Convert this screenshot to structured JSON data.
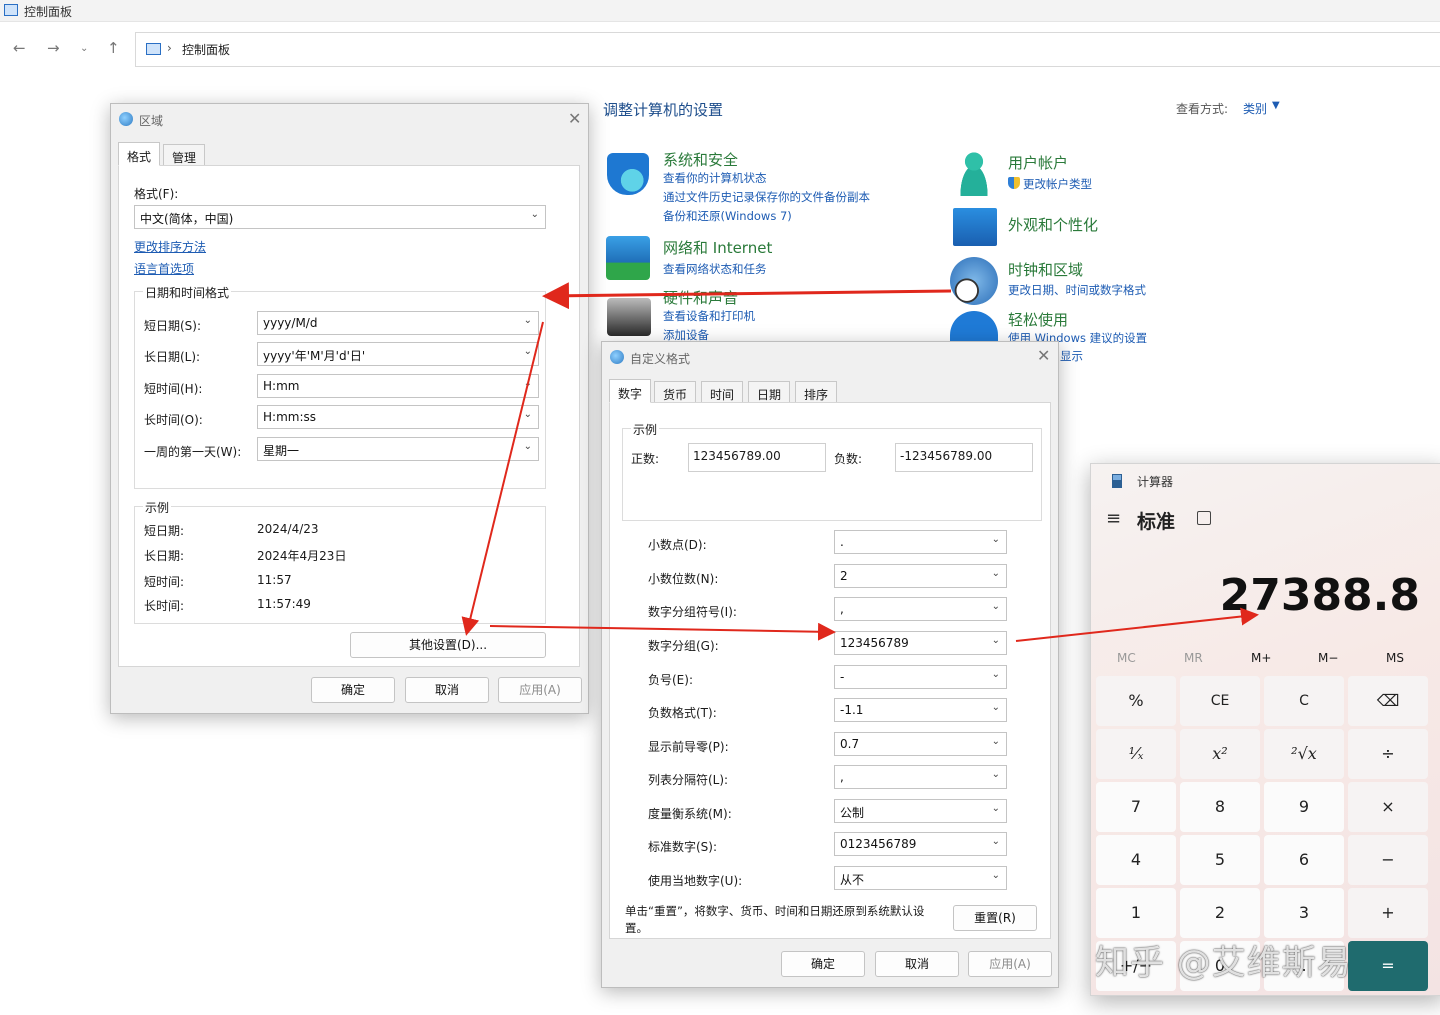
{
  "control_panel": {
    "window_title": "控制面板",
    "breadcrumb": "控制面板",
    "heading": "调整计算机的设置",
    "view_by_label": "查看方式:",
    "view_by_value": "类别",
    "categories": [
      {
        "title": "系统和安全",
        "links": [
          "查看你的计算机状态",
          "通过文件历史记录保存你的文件备份副本",
          "备份和还原(Windows 7)"
        ]
      },
      {
        "title": "网络和 Internet",
        "links": [
          "查看网络状态和任务"
        ]
      },
      {
        "title": "硬件和声音",
        "links": [
          "查看设备和打印机",
          "添加设备"
        ]
      },
      {
        "title": "用户帐户",
        "links": [
          "更改帐户类型"
        ]
      },
      {
        "title": "外观和个性化",
        "links": []
      },
      {
        "title": "时钟和区域",
        "links": [
          "更改日期、时间或数字格式"
        ]
      },
      {
        "title": "轻松使用",
        "links": [
          "使用 Windows 建议的设置",
          "显示"
        ]
      }
    ]
  },
  "region_dialog": {
    "title": "区域",
    "tabs": [
      "格式",
      "管理"
    ],
    "format_label": "格式(F):",
    "format_value": "中文(简体，中国)",
    "link_sort": "更改排序方法",
    "link_language": "语言首选项",
    "datetime_group": "日期和时间格式",
    "fields": [
      {
        "label": "短日期(S):",
        "value": "yyyy/M/d"
      },
      {
        "label": "长日期(L):",
        "value": "yyyy'年'M'月'd'日'"
      },
      {
        "label": "短时间(H):",
        "value": "H:mm"
      },
      {
        "label": "长时间(O):",
        "value": "H:mm:ss"
      },
      {
        "label": "一周的第一天(W):",
        "value": "星期一"
      }
    ],
    "example_group": "示例",
    "examples": [
      {
        "label": "短日期:",
        "value": "2024/4/23"
      },
      {
        "label": "长日期:",
        "value": "2024年4月23日"
      },
      {
        "label": "短时间:",
        "value": "11:57"
      },
      {
        "label": "长时间:",
        "value": "11:57:49"
      }
    ],
    "other_settings": "其他设置(D)...",
    "ok": "确定",
    "cancel": "取消",
    "apply": "应用(A)"
  },
  "custom_dialog": {
    "title": "自定义格式",
    "tabs": [
      "数字",
      "货币",
      "时间",
      "日期",
      "排序"
    ],
    "example_group": "示例",
    "positive_label": "正数:",
    "positive_value": "123456789.00",
    "negative_label": "负数:",
    "negative_value": "-123456789.00",
    "fields": [
      {
        "label": "小数点(D):",
        "value": "."
      },
      {
        "label": "小数位数(N):",
        "value": "2"
      },
      {
        "label": "数字分组符号(I):",
        "value": ","
      },
      {
        "label": "数字分组(G):",
        "value": "123456789"
      },
      {
        "label": "负号(E):",
        "value": "-"
      },
      {
        "label": "负数格式(T):",
        "value": "-1.1"
      },
      {
        "label": "显示前导零(P):",
        "value": "0.7"
      },
      {
        "label": "列表分隔符(L):",
        "value": ","
      },
      {
        "label": "度量衡系统(M):",
        "value": "公制"
      },
      {
        "label": "标准数字(S):",
        "value": "0123456789"
      },
      {
        "label": "使用当地数字(U):",
        "value": "从不"
      }
    ],
    "reset_note_1": "单击“重置”，将数字、货币、时间和日期还原到系统默认设",
    "reset_note_2": "置。",
    "reset": "重置(R)",
    "ok": "确定",
    "cancel": "取消",
    "apply": "应用(A)"
  },
  "calculator": {
    "title": "计算器",
    "mode": "标准",
    "display": "27388.8",
    "memory": [
      "MC",
      "MR",
      "M+",
      "M−",
      "MS"
    ],
    "keys": [
      "%",
      "CE",
      "C",
      "⌫",
      "¹⁄ₓ",
      "x²",
      "²√x",
      "÷",
      "7",
      "8",
      "9",
      "×",
      "4",
      "5",
      "6",
      "−",
      "1",
      "2",
      "3",
      "+",
      "+/−",
      "0",
      ".",
      "="
    ]
  },
  "watermark": "知乎 @艾维斯易",
  "colors": {
    "arrow": "#e0281c",
    "link": "#1e5cb3",
    "category": "#2a7a3a",
    "calc_equals": "#1f6b6e"
  }
}
